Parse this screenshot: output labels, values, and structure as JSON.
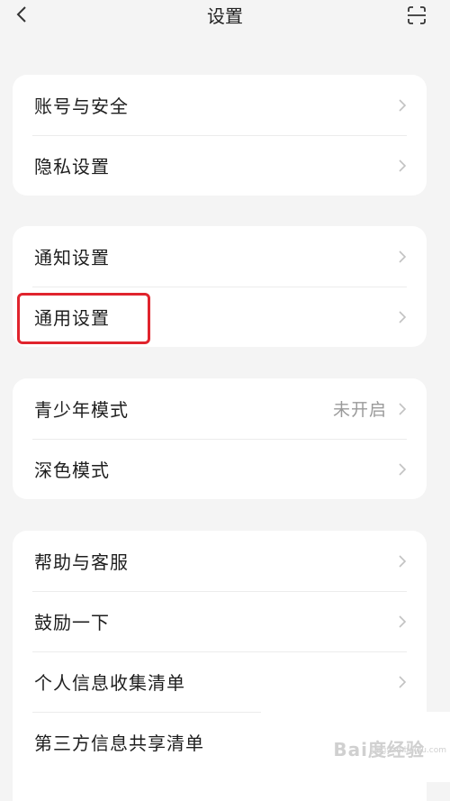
{
  "header": {
    "title": "设置",
    "back_icon": "chevron-left-icon",
    "scan_icon": "scan-icon"
  },
  "groups": [
    {
      "items": [
        {
          "label": "账号与安全"
        },
        {
          "label": "隐私设置"
        }
      ]
    },
    {
      "items": [
        {
          "label": "通知设置"
        },
        {
          "label": "通用设置"
        }
      ]
    },
    {
      "items": [
        {
          "label": "青少年模式",
          "value": "未开启"
        },
        {
          "label": "深色模式"
        }
      ]
    },
    {
      "items": [
        {
          "label": "帮助与客服"
        },
        {
          "label": "鼓励一下"
        },
        {
          "label": "个人信息收集清单"
        },
        {
          "label": "第三方信息共享清单"
        }
      ]
    }
  ],
  "annotation": {
    "color": "#e0242d"
  },
  "watermark": {
    "text": "Bai度经验",
    "subtext": "jingyan.baidu.com"
  }
}
